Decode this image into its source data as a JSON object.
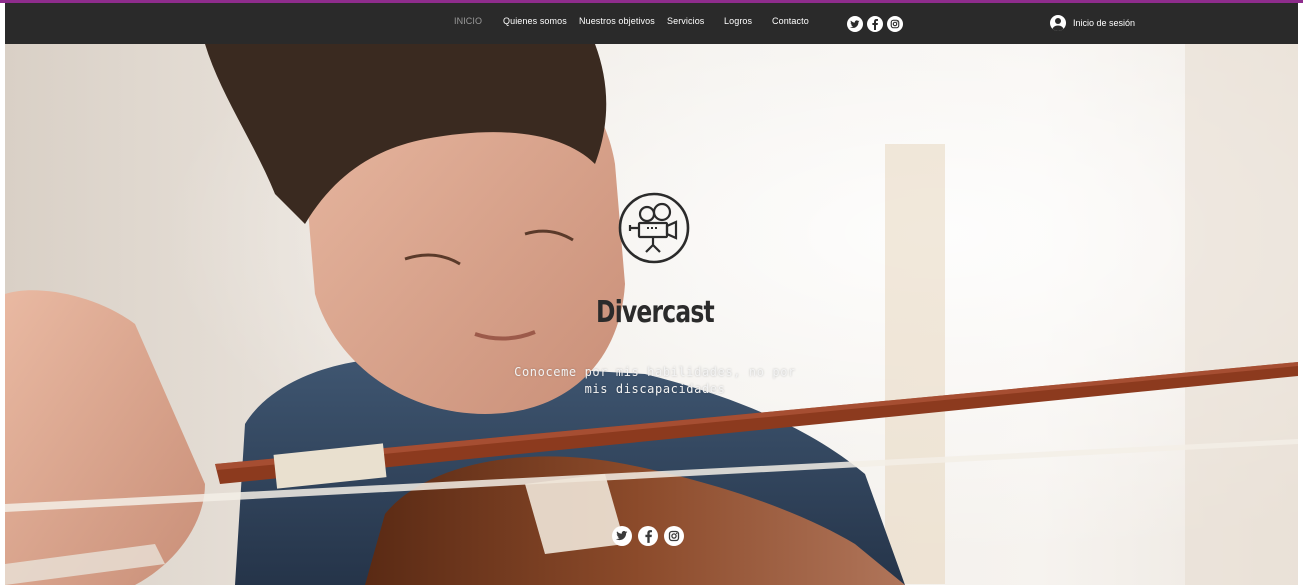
{
  "nav": {
    "links": [
      {
        "label": "INICIO",
        "active": true
      },
      {
        "label": "Quienes somos",
        "active": false
      },
      {
        "label": "Nuestros objetivos",
        "active": false
      },
      {
        "label": "Servicios",
        "active": false
      },
      {
        "label": "Logros",
        "active": false
      },
      {
        "label": "Contacto",
        "active": false
      }
    ],
    "social_icons": [
      "twitter-icon",
      "facebook-icon",
      "instagram-icon"
    ],
    "login_label": "Inicio de sesión"
  },
  "hero": {
    "title": "Divercast",
    "tagline_line1": "Conoceme por mis habilidades, no por",
    "tagline_line2": "mis discapacidades",
    "logo_icon": "film-camera-icon",
    "social_icons": [
      "twitter-icon",
      "facebook-icon",
      "instagram-icon"
    ]
  },
  "colors": {
    "navbar": "#2a2a2a",
    "accent": "#8e2c8c",
    "nav_active": "#9a9a9a",
    "text_light": "#ffffff",
    "title": "#2b2b2b"
  }
}
